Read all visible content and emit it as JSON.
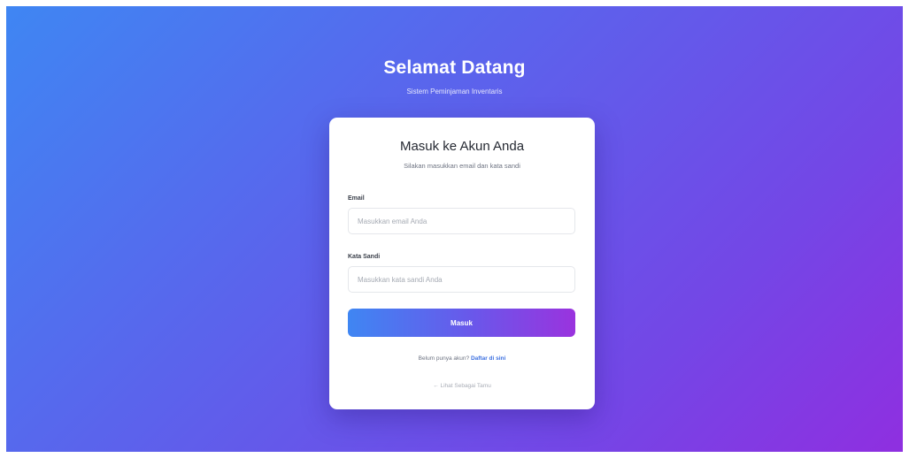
{
  "hero": {
    "title": "Selamat Datang",
    "subtitle": "Sistem Peminjaman Inventaris"
  },
  "card": {
    "title": "Masuk ke Akun Anda",
    "subtitle": "Silakan masukkan email dan kata sandi"
  },
  "form": {
    "email": {
      "label": "Email",
      "placeholder": "Masukkan email Anda",
      "value": ""
    },
    "password": {
      "label": "Kata Sandi",
      "placeholder": "Masukkan kata sandi Anda",
      "value": ""
    },
    "submit_label": "Masuk"
  },
  "register": {
    "prompt": "Belum punya akun?",
    "link_label": "Daftar di sini"
  },
  "guest_link": "← Lihat Sebagai Tamu",
  "colors": {
    "gradient_start": "#3f86f3",
    "gradient_end": "#8f2fe0",
    "link": "#3b6fe0"
  }
}
